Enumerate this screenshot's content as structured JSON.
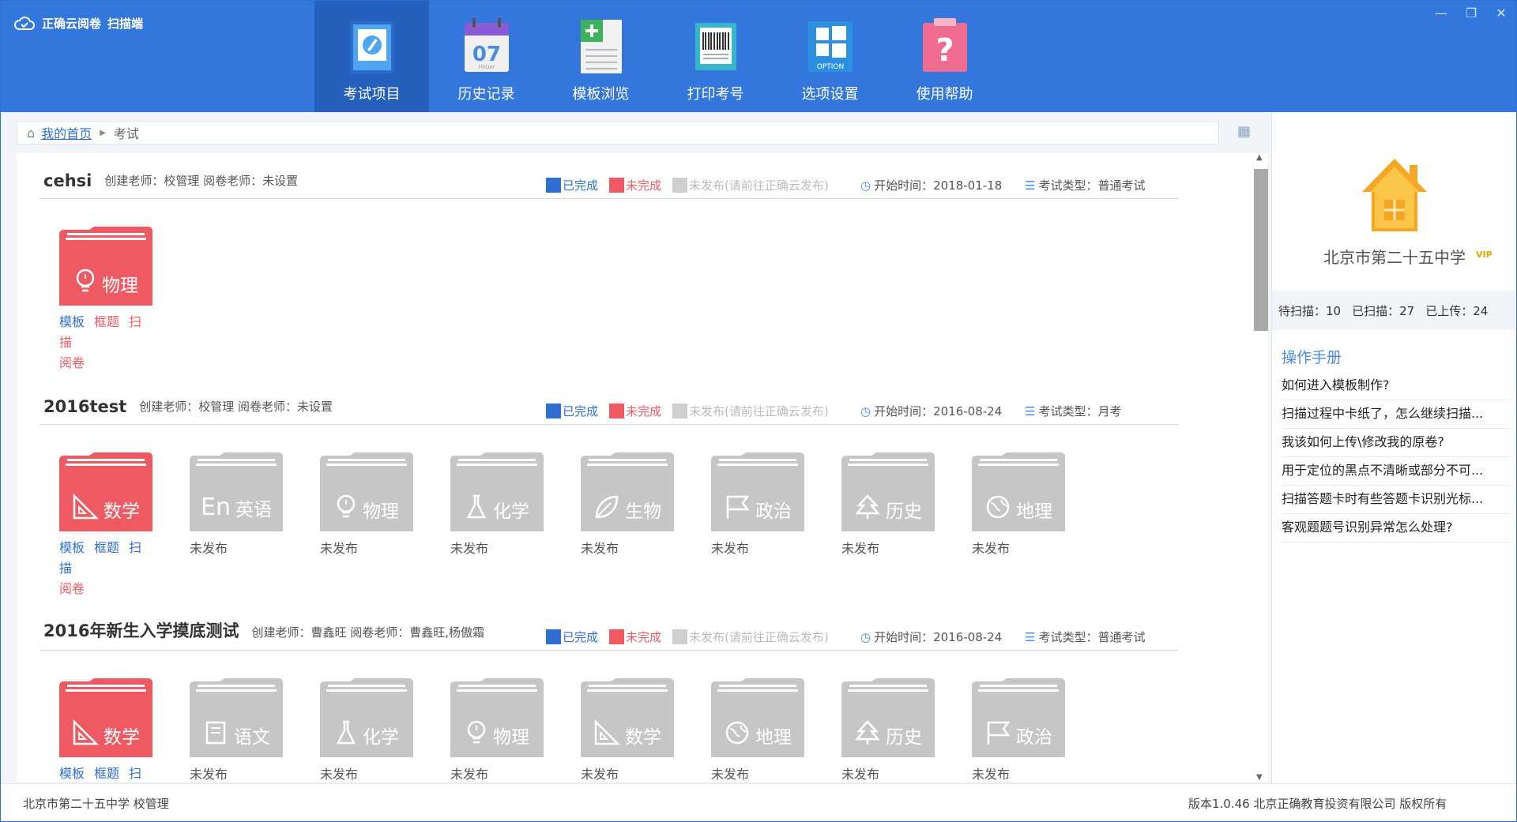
{
  "app": {
    "title": "正确云阅卷",
    "subtitle": "扫描端"
  },
  "toolbar": [
    {
      "label": "考试项目",
      "icon": "exam-edit-icon"
    },
    {
      "label": "历史记录",
      "icon": "calendar-icon",
      "day": "07",
      "weekday": "FRIDAY"
    },
    {
      "label": "模板浏览",
      "icon": "template-doc-icon"
    },
    {
      "label": "打印考号",
      "icon": "barcode-ticket-icon"
    },
    {
      "label": "选项设置",
      "icon": "windows-option-icon",
      "badge": "OPTION"
    },
    {
      "label": "使用帮助",
      "icon": "help-question-icon",
      "glyph": "?"
    }
  ],
  "breadcrumb": {
    "home": "我的首页",
    "current": "考试"
  },
  "legend": {
    "done": "已完成",
    "undone": "未完成",
    "unpublished": "未发布(请前往正确云发布)"
  },
  "labels": {
    "start": "开始时间：",
    "type": "考试类型：",
    "creator": "创建老师：",
    "reviewer": "阅卷老师："
  },
  "actions": {
    "template": "模板",
    "box": "框题",
    "scan": "扫描",
    "review": "阅卷"
  },
  "exams": [
    {
      "name": "cehsi",
      "creator": "校管理",
      "reviewer": "未设置",
      "start": "2018-01-18",
      "type": "普通考试",
      "subjects": [
        {
          "name": "物理",
          "icon": "bulb",
          "state": "active"
        }
      ]
    },
    {
      "name": "2016test",
      "creator": "校管理",
      "reviewer": "未设置",
      "start": "2016-08-24",
      "type": "月考",
      "subjects": [
        {
          "name": "数学",
          "icon": "ruler",
          "state": "active"
        },
        {
          "name": "英语",
          "icon": "En",
          "state": "unpublished",
          "status": "未发布"
        },
        {
          "name": "物理",
          "icon": "bulb",
          "state": "unpublished",
          "status": "未发布"
        },
        {
          "name": "化学",
          "icon": "flask",
          "state": "unpublished",
          "status": "未发布"
        },
        {
          "name": "生物",
          "icon": "leaf",
          "state": "unpublished",
          "status": "未发布"
        },
        {
          "name": "政治",
          "icon": "flag",
          "state": "unpublished",
          "status": "未发布"
        },
        {
          "name": "历史",
          "icon": "tree",
          "state": "unpublished",
          "status": "未发布"
        },
        {
          "name": "地理",
          "icon": "globe",
          "state": "unpublished",
          "status": "未发布"
        }
      ]
    },
    {
      "name": "2016年新生入学摸底测试",
      "creator": "曹鑫旺",
      "reviewer": "曹鑫旺,杨傲霜",
      "start": "2016-08-24",
      "type": "普通考试",
      "subjects": [
        {
          "name": "数学",
          "icon": "ruler",
          "state": "active"
        },
        {
          "name": "语文",
          "icon": "book",
          "state": "unpublished",
          "status": "未发布"
        },
        {
          "name": "化学",
          "icon": "flask",
          "state": "unpublished",
          "status": "未发布"
        },
        {
          "name": "物理",
          "icon": "bulb",
          "state": "unpublished",
          "status": "未发布"
        },
        {
          "name": "数学",
          "icon": "ruler",
          "state": "unpublished",
          "status": "未发布"
        },
        {
          "name": "地理",
          "icon": "globe",
          "state": "unpublished",
          "status": "未发布"
        },
        {
          "name": "历史",
          "icon": "tree",
          "state": "unpublished",
          "status": "未发布"
        },
        {
          "name": "政治",
          "icon": "flag",
          "state": "unpublished",
          "status": "未发布"
        }
      ]
    }
  ],
  "school": {
    "name": "北京市第二十五中学",
    "vip": "VIP"
  },
  "counts": {
    "pending_label": "待扫描：",
    "pending": "10",
    "scanned_label": "已扫描：",
    "scanned": "27",
    "uploaded_label": "已上传：",
    "uploaded": "24"
  },
  "manual": {
    "title": "操作手册",
    "questions": [
      "如何进入模板制作?",
      "扫描过程中卡纸了，怎么继续扫描...",
      "我该如何上传\\修改我的原卷?",
      "用于定位的黑点不清晰或部分不可...",
      "扫描答题卡时有些答题卡识别光标...",
      "客观题题号识别异常怎么处理?"
    ]
  },
  "footer": {
    "left": "北京市第二十五中学  校管理",
    "right": "版本1.0.46 北京正确教育投资有限公司 版权所有"
  },
  "colors": {
    "brand": "#3377dd",
    "active_folder": "#ef5a62",
    "inactive_folder": "#c6c6c6",
    "done": "#2f6fd3",
    "undone": "#f25a63",
    "unpublished": "#cfcfcf"
  }
}
